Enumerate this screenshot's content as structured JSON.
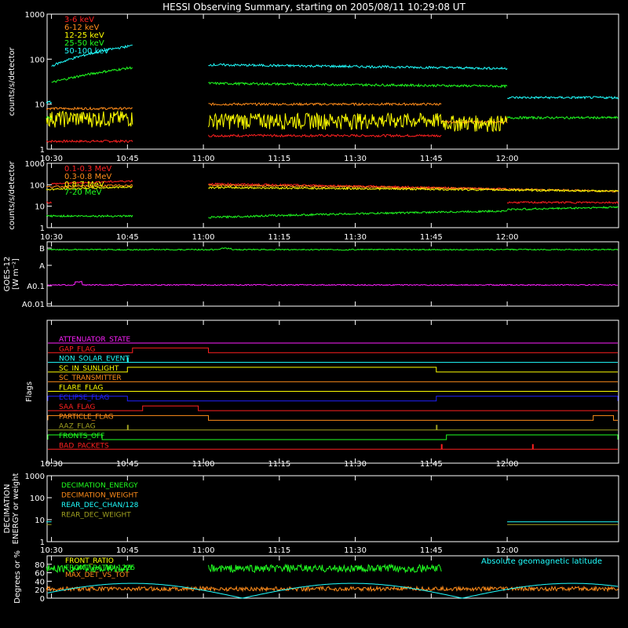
{
  "title": "HESSI Observing Summary, starting on 2005/08/11 10:29:08 UT",
  "colors": {
    "red": "#ff2020",
    "orange": "#ff8c1a",
    "yellow": "#ffff00",
    "green": "#20ff20",
    "cyan": "#20ffff",
    "magenta": "#ff20ff",
    "blue": "#2020ff",
    "olive": "#a0a020",
    "white": "#ffffff"
  },
  "time_ticks": [
    "10:30",
    "10:45",
    "11:00",
    "11:15",
    "11:30",
    "11:45",
    "12:00"
  ],
  "chart_data": [
    {
      "type": "line",
      "id": "lo-energy",
      "ylabel": "counts/s/detector",
      "y_scale": "log",
      "ylim": [
        1,
        1000
      ],
      "y_ticks": [
        "1",
        "10",
        "100",
        "1000"
      ],
      "x_range": [
        "10:29:08",
        "12:22"
      ],
      "legend": "top-left",
      "series": [
        {
          "name": "3-6 keV",
          "color": "red",
          "segments": [
            [
              "10:29",
              "10:46",
              1.5
            ],
            [
              "11:01",
              "11:47",
              2.0
            ]
          ]
        },
        {
          "name": "6-12 keV",
          "color": "orange",
          "segments": [
            [
              "10:29",
              "10:46",
              8.0
            ],
            [
              "11:01",
              "11:47",
              10.0
            ],
            [
              "11:47",
              "12:00",
              4.0
            ]
          ]
        },
        {
          "name": "12-25 keV",
          "color": "yellow",
          "segments": [
            [
              "10:29",
              "10:46",
              5.0
            ],
            [
              "11:01",
              "11:47",
              4.5
            ],
            [
              "11:47",
              "12:00",
              4.0
            ]
          ]
        },
        {
          "name": "25-50 keV",
          "color": "green",
          "segments": [
            [
              "10:29",
              "10:30",
              5.0
            ],
            [
              "10:30",
              "10:46",
              30,
              65
            ],
            [
              "11:01",
              "12:00",
              29,
              25
            ],
            [
              "12:00",
              "12:22",
              5.0
            ]
          ]
        },
        {
          "name": "50-100 keV",
          "color": "cyan",
          "segments": [
            [
              "10:29",
              "10:30",
              11
            ],
            [
              "10:30",
              "10:46",
              70,
              200
            ],
            [
              "11:01",
              "12:00",
              75,
              62
            ],
            [
              "12:00",
              "12:22",
              14
            ]
          ]
        }
      ]
    },
    {
      "type": "line",
      "id": "hi-energy",
      "ylabel": "counts/s/detector",
      "y_scale": "log",
      "ylim": [
        1,
        1000
      ],
      "y_ticks": [
        "1",
        "10",
        "100",
        "1000"
      ],
      "legend": "top-left",
      "series": [
        {
          "name": "0.1-0.3 MeV",
          "color": "red",
          "segments": [
            [
              "10:29",
              "10:30",
              15
            ],
            [
              "10:30",
              "10:46",
              110,
              150
            ],
            [
              "11:01",
              "12:00",
              110,
              62
            ],
            [
              "12:00",
              "12:22",
              15
            ]
          ]
        },
        {
          "name": "0.3-0.8 MeV",
          "color": "orange",
          "segments": [
            [
              "10:29",
              "10:46",
              80,
              95
            ],
            [
              "11:01",
              "12:22",
              95,
              50
            ]
          ]
        },
        {
          "name": "0.8-7 MeV",
          "color": "yellow",
          "segments": [
            [
              "10:29",
              "10:46",
              60,
              80
            ],
            [
              "11:01",
              "12:22",
              75,
              50
            ]
          ]
        },
        {
          "name": "7-20 MeV",
          "color": "green",
          "segments": [
            [
              "10:29",
              "10:46",
              3.5
            ],
            [
              "11:01",
              "12:00",
              3.0,
              6.0
            ],
            [
              "12:00",
              "12:22",
              7,
              9
            ]
          ]
        }
      ]
    },
    {
      "type": "line",
      "id": "goes",
      "ylabel": "GOES-12",
      "ylabel2": "[W m⁻²]",
      "y_ticks": [
        "B",
        "A",
        "A0.1",
        "A0.01"
      ],
      "series": [
        {
          "name": "long",
          "color": "green",
          "level": "B"
        },
        {
          "name": "short",
          "color": "magenta",
          "level": "A0.1"
        }
      ]
    },
    {
      "type": "line",
      "id": "flags",
      "ylabel": "Flags",
      "series": [
        {
          "name": "ATTENUATOR_STATE",
          "color": "magenta",
          "on": []
        },
        {
          "name": "GAP_FLAG",
          "color": "red",
          "on": [
            [
              "10:46",
              "11:01"
            ]
          ]
        },
        {
          "name": "NON_SOLAR_EVENT",
          "color": "cyan",
          "on": [
            [
              "10:45",
              "10:45"
            ]
          ]
        },
        {
          "name": "SC_IN_SUNLIGHT",
          "color": "yellow",
          "on": [
            [
              "10:45",
              "11:46"
            ]
          ]
        },
        {
          "name": "SC_TRANSMITTER",
          "color": "orange",
          "on": []
        },
        {
          "name": "FLARE_FLAG",
          "color": "yellow",
          "on": []
        },
        {
          "name": "ECLIPSE_FLAG",
          "color": "blue",
          "on": [
            [
              "10:29",
              "10:45"
            ],
            [
              "11:46",
              "12:22"
            ]
          ]
        },
        {
          "name": "SAA_FLAG",
          "color": "red",
          "on": [
            [
              "10:48",
              "10:59"
            ]
          ]
        },
        {
          "name": "PARTICLE_FLAG",
          "color": "orange",
          "on": [
            [
              "10:29",
              "11:01"
            ],
            [
              "12:17",
              "12:21"
            ]
          ]
        },
        {
          "name": "AAZ_FLAG",
          "color": "olive",
          "on": [
            [
              "10:45",
              "10:45"
            ],
            [
              "11:46",
              "11:46"
            ]
          ]
        },
        {
          "name": "FRONTS_OFF",
          "color": "green",
          "on": [
            [
              "10:29",
              "10:40"
            ],
            [
              "11:48",
              "12:22"
            ]
          ]
        },
        {
          "name": "BAD_PACKETS",
          "color": "red",
          "on": [
            [
              "11:47",
              "11:47"
            ],
            [
              "12:05",
              "12:05"
            ]
          ]
        }
      ]
    },
    {
      "type": "line",
      "id": "decimation",
      "ylabel": "DECIMATION",
      "ylabel2": "ENERGY or weight",
      "y_scale": "log",
      "ylim": [
        1,
        1000
      ],
      "y_ticks": [
        "1",
        "10",
        "100",
        "1000"
      ],
      "series": [
        {
          "name": "DECIMATION_ENERGY",
          "color": "green",
          "segments": []
        },
        {
          "name": "DECIMATION_WEIGHT",
          "color": "orange",
          "segments": []
        },
        {
          "name": "REAR_DEC_CHAN/128",
          "color": "cyan",
          "segments": [
            [
              "10:29",
              "10:30",
              8
            ],
            [
              "12:00",
              "12:22",
              8
            ]
          ]
        },
        {
          "name": "REAR_DEC_WEIGHT",
          "color": "olive",
          "segments": [
            [
              "10:29",
              "10:30",
              6
            ],
            [
              "12:00",
              "12:22",
              6
            ]
          ]
        }
      ]
    },
    {
      "type": "line",
      "id": "ratios",
      "ylabel": "Degrees or %",
      "ylim": [
        0,
        100
      ],
      "y_ticks": [
        "0",
        "20",
        "40",
        "60",
        "80"
      ],
      "annotation": "Absolute geomagnetic latitude",
      "series": [
        {
          "name": "FRONT_RATIO",
          "color": "yellow",
          "segments": []
        },
        {
          "name": "FRONT_RATIO_1225",
          "color": "green",
          "segments": [
            [
              "10:29",
              "10:46",
              70
            ],
            [
              "11:01",
              "11:47",
              70
            ]
          ]
        },
        {
          "name": "MAX_DET_VS_TOT",
          "color": "orange",
          "segments": [
            [
              "10:29",
              "12:22",
              22
            ]
          ]
        }
      ]
    }
  ]
}
